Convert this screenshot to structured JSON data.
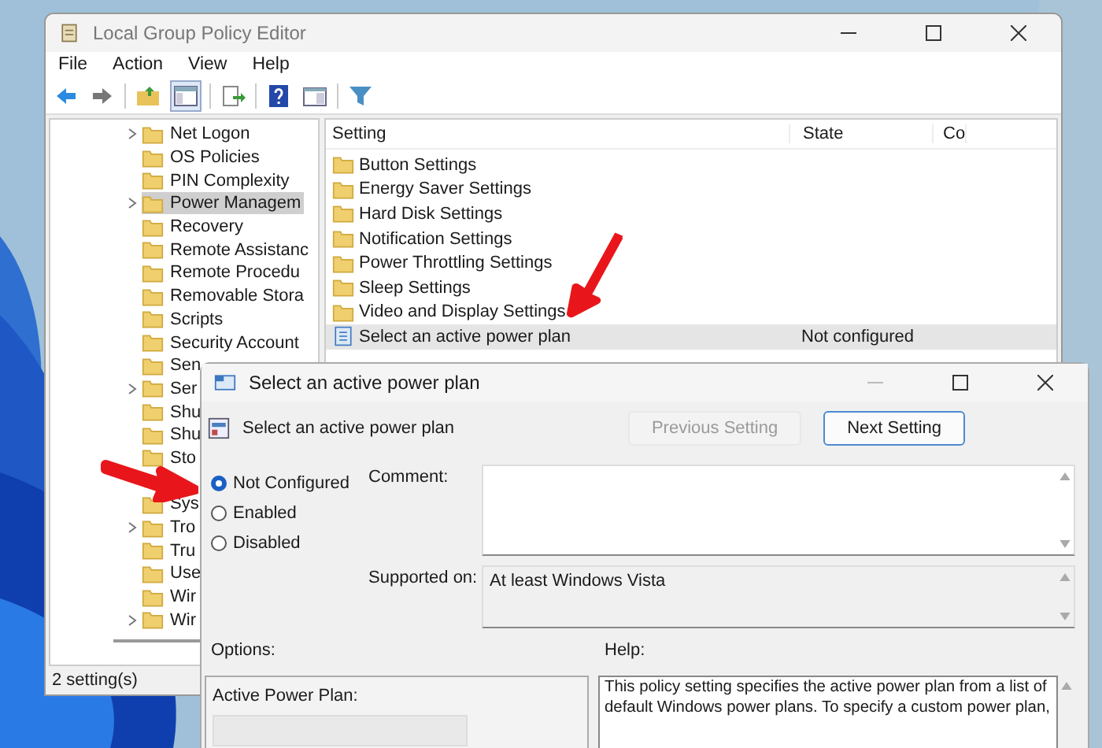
{
  "main_window": {
    "title": "Local Group Policy Editor",
    "menu": [
      "File",
      "Action",
      "View",
      "Help"
    ],
    "tree": [
      {
        "label": "Net Logon",
        "expandable": true,
        "selected": false
      },
      {
        "label": "OS Policies",
        "expandable": false,
        "selected": false
      },
      {
        "label": "PIN Complexity",
        "expandable": false,
        "selected": false
      },
      {
        "label": "Power Managem",
        "expandable": true,
        "selected": true
      },
      {
        "label": "Recovery",
        "expandable": false,
        "selected": false
      },
      {
        "label": "Remote Assistanc",
        "expandable": false,
        "selected": false
      },
      {
        "label": "Remote Procedu",
        "expandable": false,
        "selected": false
      },
      {
        "label": "Removable Stora",
        "expandable": false,
        "selected": false
      },
      {
        "label": "Scripts",
        "expandable": false,
        "selected": false
      },
      {
        "label": "Security Account",
        "expandable": false,
        "selected": false
      },
      {
        "label": "Sen",
        "expandable": false,
        "selected": false
      },
      {
        "label": "Ser",
        "expandable": true,
        "selected": false
      },
      {
        "label": "Shu",
        "expandable": false,
        "selected": false
      },
      {
        "label": "Shu",
        "expandable": false,
        "selected": false
      },
      {
        "label": "Sto",
        "expandable": false,
        "selected": false
      },
      {
        "expandable": false
      },
      {
        "label": "Sys",
        "expandable": false,
        "selected": false
      },
      {
        "label": "Tro",
        "expandable": true,
        "selected": false
      },
      {
        "label": "Tru",
        "expandable": false,
        "selected": false
      },
      {
        "label": "Use",
        "expandable": false,
        "selected": false
      },
      {
        "label": "Wir",
        "expandable": false,
        "selected": false
      },
      {
        "label": "Wir",
        "expandable": true,
        "selected": false
      }
    ],
    "list": {
      "columns": [
        "Setting",
        "State",
        "Co"
      ],
      "rows": [
        {
          "kind": "folder",
          "name": "Button Settings",
          "selected": false
        },
        {
          "kind": "folder",
          "name": "Energy Saver Settings",
          "selected": false
        },
        {
          "kind": "folder",
          "name": "Hard Disk Settings",
          "selected": false
        },
        {
          "kind": "folder",
          "name": "Notification Settings",
          "selected": false
        },
        {
          "kind": "folder",
          "name": "Power Throttling Settings",
          "selected": false
        },
        {
          "kind": "folder",
          "name": "Sleep Settings",
          "selected": false
        },
        {
          "kind": "folder",
          "name": "Video and Display Settings",
          "selected": false
        },
        {
          "kind": "policy",
          "name": "Select an active power plan",
          "state": "Not configured",
          "selected": true
        }
      ]
    },
    "status_bar": "2 setting(s)"
  },
  "dialog": {
    "title": "Select an active power plan",
    "heading": "Select an active power plan",
    "buttons": [
      {
        "label": "Previous Setting",
        "disabled": true
      },
      {
        "label": "Next Setting",
        "disabled": false
      }
    ],
    "choices": [
      {
        "label": "Not Configured",
        "selected": true
      },
      {
        "label": "Enabled",
        "selected": false
      },
      {
        "label": "Disabled",
        "selected": false
      }
    ],
    "comment_label": "Comment:",
    "supported_label": "Supported on:",
    "supported_value": "At least Windows Vista",
    "options_label": "Options:",
    "help_label": "Help:",
    "option_field_label": "Active Power Plan:",
    "help_lines": [
      "This policy setting specifies the active power plan from a list of",
      "default Windows power plans. To specify a custom power plan,"
    ]
  }
}
